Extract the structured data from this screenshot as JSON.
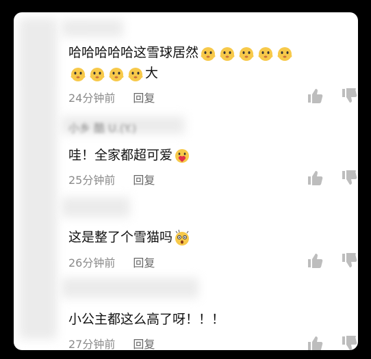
{
  "comments": [
    {
      "text_a": "哈哈哈哈哈这雪球居然",
      "text_b": "大",
      "time": "24分钟前",
      "reply": "回复"
    },
    {
      "username_partial": "小乡 酷 U.(Y.)",
      "text": "哇！全家都超可爱",
      "time": "25分钟前",
      "reply": "回复"
    },
    {
      "text": "这是整了个雪猫吗",
      "time": "26分钟前",
      "reply": "回复"
    },
    {
      "text": "小公主都这么高了呀！！！",
      "time": "27分钟前",
      "reply": "回复"
    }
  ],
  "icons": {
    "like": "thumbs-up-icon",
    "dislike": "thumbs-down-icon",
    "emoji_1": "laughing-face-emoji",
    "emoji_2": "heart-face-emoji",
    "emoji_3": "shocked-face-emoji"
  },
  "colors": {
    "text": "#111111",
    "meta": "#8a8a8a",
    "icon": "#bdbdbd",
    "emoji_yellow": "#f7c94a"
  }
}
